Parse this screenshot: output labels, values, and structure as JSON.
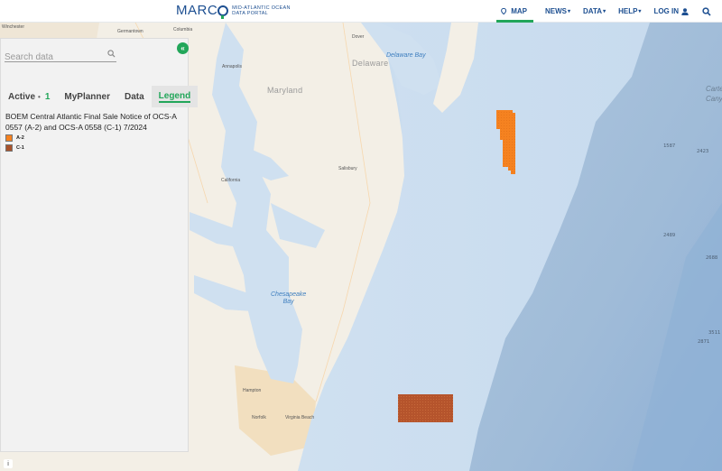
{
  "header": {
    "logo_main": "MARC",
    "logo_sub_line1": "Mid-Atlantic Ocean",
    "logo_sub_line2": "Data Portal",
    "nav": [
      {
        "label": "MAP",
        "icon": "map-pin-icon",
        "active": true
      },
      {
        "label": "NEWS",
        "dropdown": true
      },
      {
        "label": "DATA",
        "dropdown": true
      },
      {
        "label": "HELP",
        "dropdown": true
      },
      {
        "label": "LOG IN",
        "icon": "user-icon"
      },
      {
        "label": "",
        "icon": "search-icon"
      }
    ],
    "caret": "▾"
  },
  "sidebar": {
    "search_placeholder": "Search data",
    "collapse_glyph": "«",
    "tabs": [
      {
        "label": "Active",
        "separator": "•",
        "count": "1"
      },
      {
        "label": "MyPlanner"
      },
      {
        "label": "Data"
      },
      {
        "label": "Legend",
        "active": true
      }
    ],
    "legend": {
      "title": "BOEM Central Atlantic Final Sale Notice of OCS-A 0557 (A-2) and OCS-A 0558 (C-1) 7/2024",
      "items": [
        {
          "label": "A-2",
          "color": "#f58220"
        },
        {
          "label": "C-1",
          "color": "#a8522a"
        }
      ]
    }
  },
  "map": {
    "labels": {
      "winchester": "Winchester",
      "germantown": "Germantown",
      "columbia": "Columbia",
      "annapolis": "Annapolis",
      "dover": "Dover",
      "delaware": "Delaware",
      "maryland": "Maryland",
      "delaware_bay": "Delaware Bay",
      "salisbury": "Salisbury",
      "california": "California",
      "chesapeake_bay_1": "Chesapeake",
      "chesapeake_bay_2": "Bay",
      "hampton": "Hampton",
      "norfolk": "Norfolk",
      "virginia_beach": "Virginia Beach",
      "carteret_canyon_1": "Carte",
      "carteret_canyon_2": "Canyo",
      "depth_1587": "1587",
      "depth_2423": "2423",
      "depth_2489": "2489",
      "depth_2688": "2688",
      "depth_3511": "3511",
      "depth_2871": "2871"
    },
    "layers": [
      {
        "name": "A-2",
        "color": "#f58220"
      },
      {
        "name": "C-1",
        "color": "#a8522a"
      }
    ],
    "info_glyph": "i"
  }
}
